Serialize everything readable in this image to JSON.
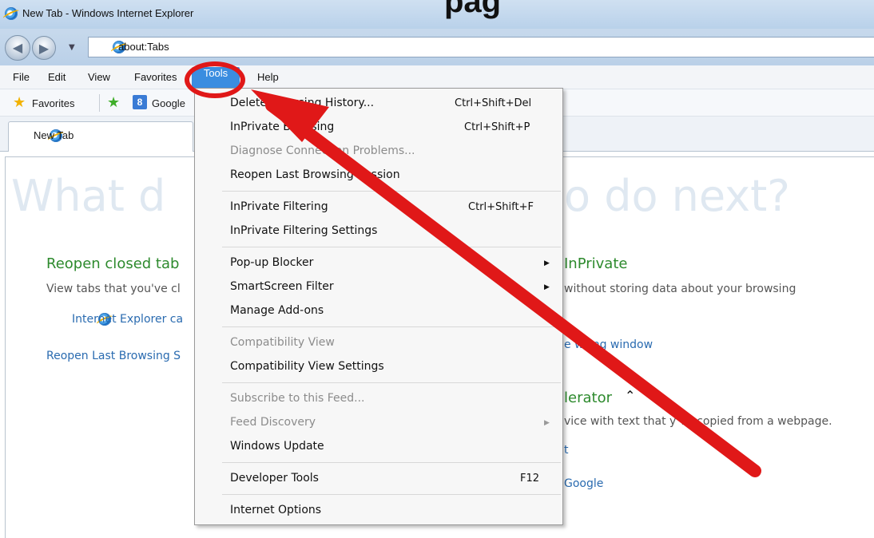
{
  "window": {
    "title": "New Tab - Windows Internet Explorer",
    "heading_fragment": "pag"
  },
  "address": {
    "url": "about:Tabs"
  },
  "menubar": {
    "file": "File",
    "edit": "Edit",
    "view": "View",
    "favorites": "Favorites",
    "tools": "Tools",
    "help": "Help"
  },
  "favorites_bar": {
    "favorites": "Favorites",
    "google": "Google"
  },
  "tab": {
    "label": "New Tab"
  },
  "tools_menu": {
    "items": [
      {
        "label": "Delete Browsing History...",
        "shortcut": "Ctrl+Shift+Del"
      },
      {
        "label": "InPrivate Browsing",
        "shortcut": "Ctrl+Shift+P"
      },
      {
        "label": "Diagnose Connection Problems..."
      },
      {
        "label": "Reopen Last Browsing Session"
      },
      {
        "label": "InPrivate Filtering",
        "shortcut": "Ctrl+Shift+F"
      },
      {
        "label": "InPrivate Filtering Settings"
      },
      {
        "label": "Pop-up Blocker"
      },
      {
        "label": "SmartScreen Filter"
      },
      {
        "label": "Manage Add-ons"
      },
      {
        "label": "Compatibility View"
      },
      {
        "label": "Compatibility View Settings"
      },
      {
        "label": "Subscribe to this Feed..."
      },
      {
        "label": "Feed Discovery"
      },
      {
        "label": "Windows Update"
      },
      {
        "label": "Developer Tools",
        "shortcut": "F12"
      },
      {
        "label": "Internet Options"
      }
    ]
  },
  "content": {
    "headline_left": "What d",
    "headline_right": "o do next?",
    "reopen": {
      "heading": "Reopen closed tab",
      "desc": "View tabs that you've cl",
      "ie_link": "Internet Explorer ca",
      "reopen_link": "Reopen Last Browsing S"
    },
    "inprivate": {
      "heading": "InPrivate",
      "desc": "without storing data about your browsing",
      "link": "e   wsing window"
    },
    "accelerator": {
      "heading": "lerator",
      "desc": "vice with text that y    ve copied from a webpage.",
      "link1": "t",
      "link2": "Google"
    }
  },
  "colors": {
    "accent": "#3a8de0",
    "annotation_red": "#e01818",
    "link_blue": "#2a6bb0",
    "section_green": "#2d8a2d"
  },
  "icons": {
    "browser": "ie-logo-icon",
    "favorites": "star-icon",
    "add_favorite": "add-star-icon",
    "google": "google-icon"
  }
}
